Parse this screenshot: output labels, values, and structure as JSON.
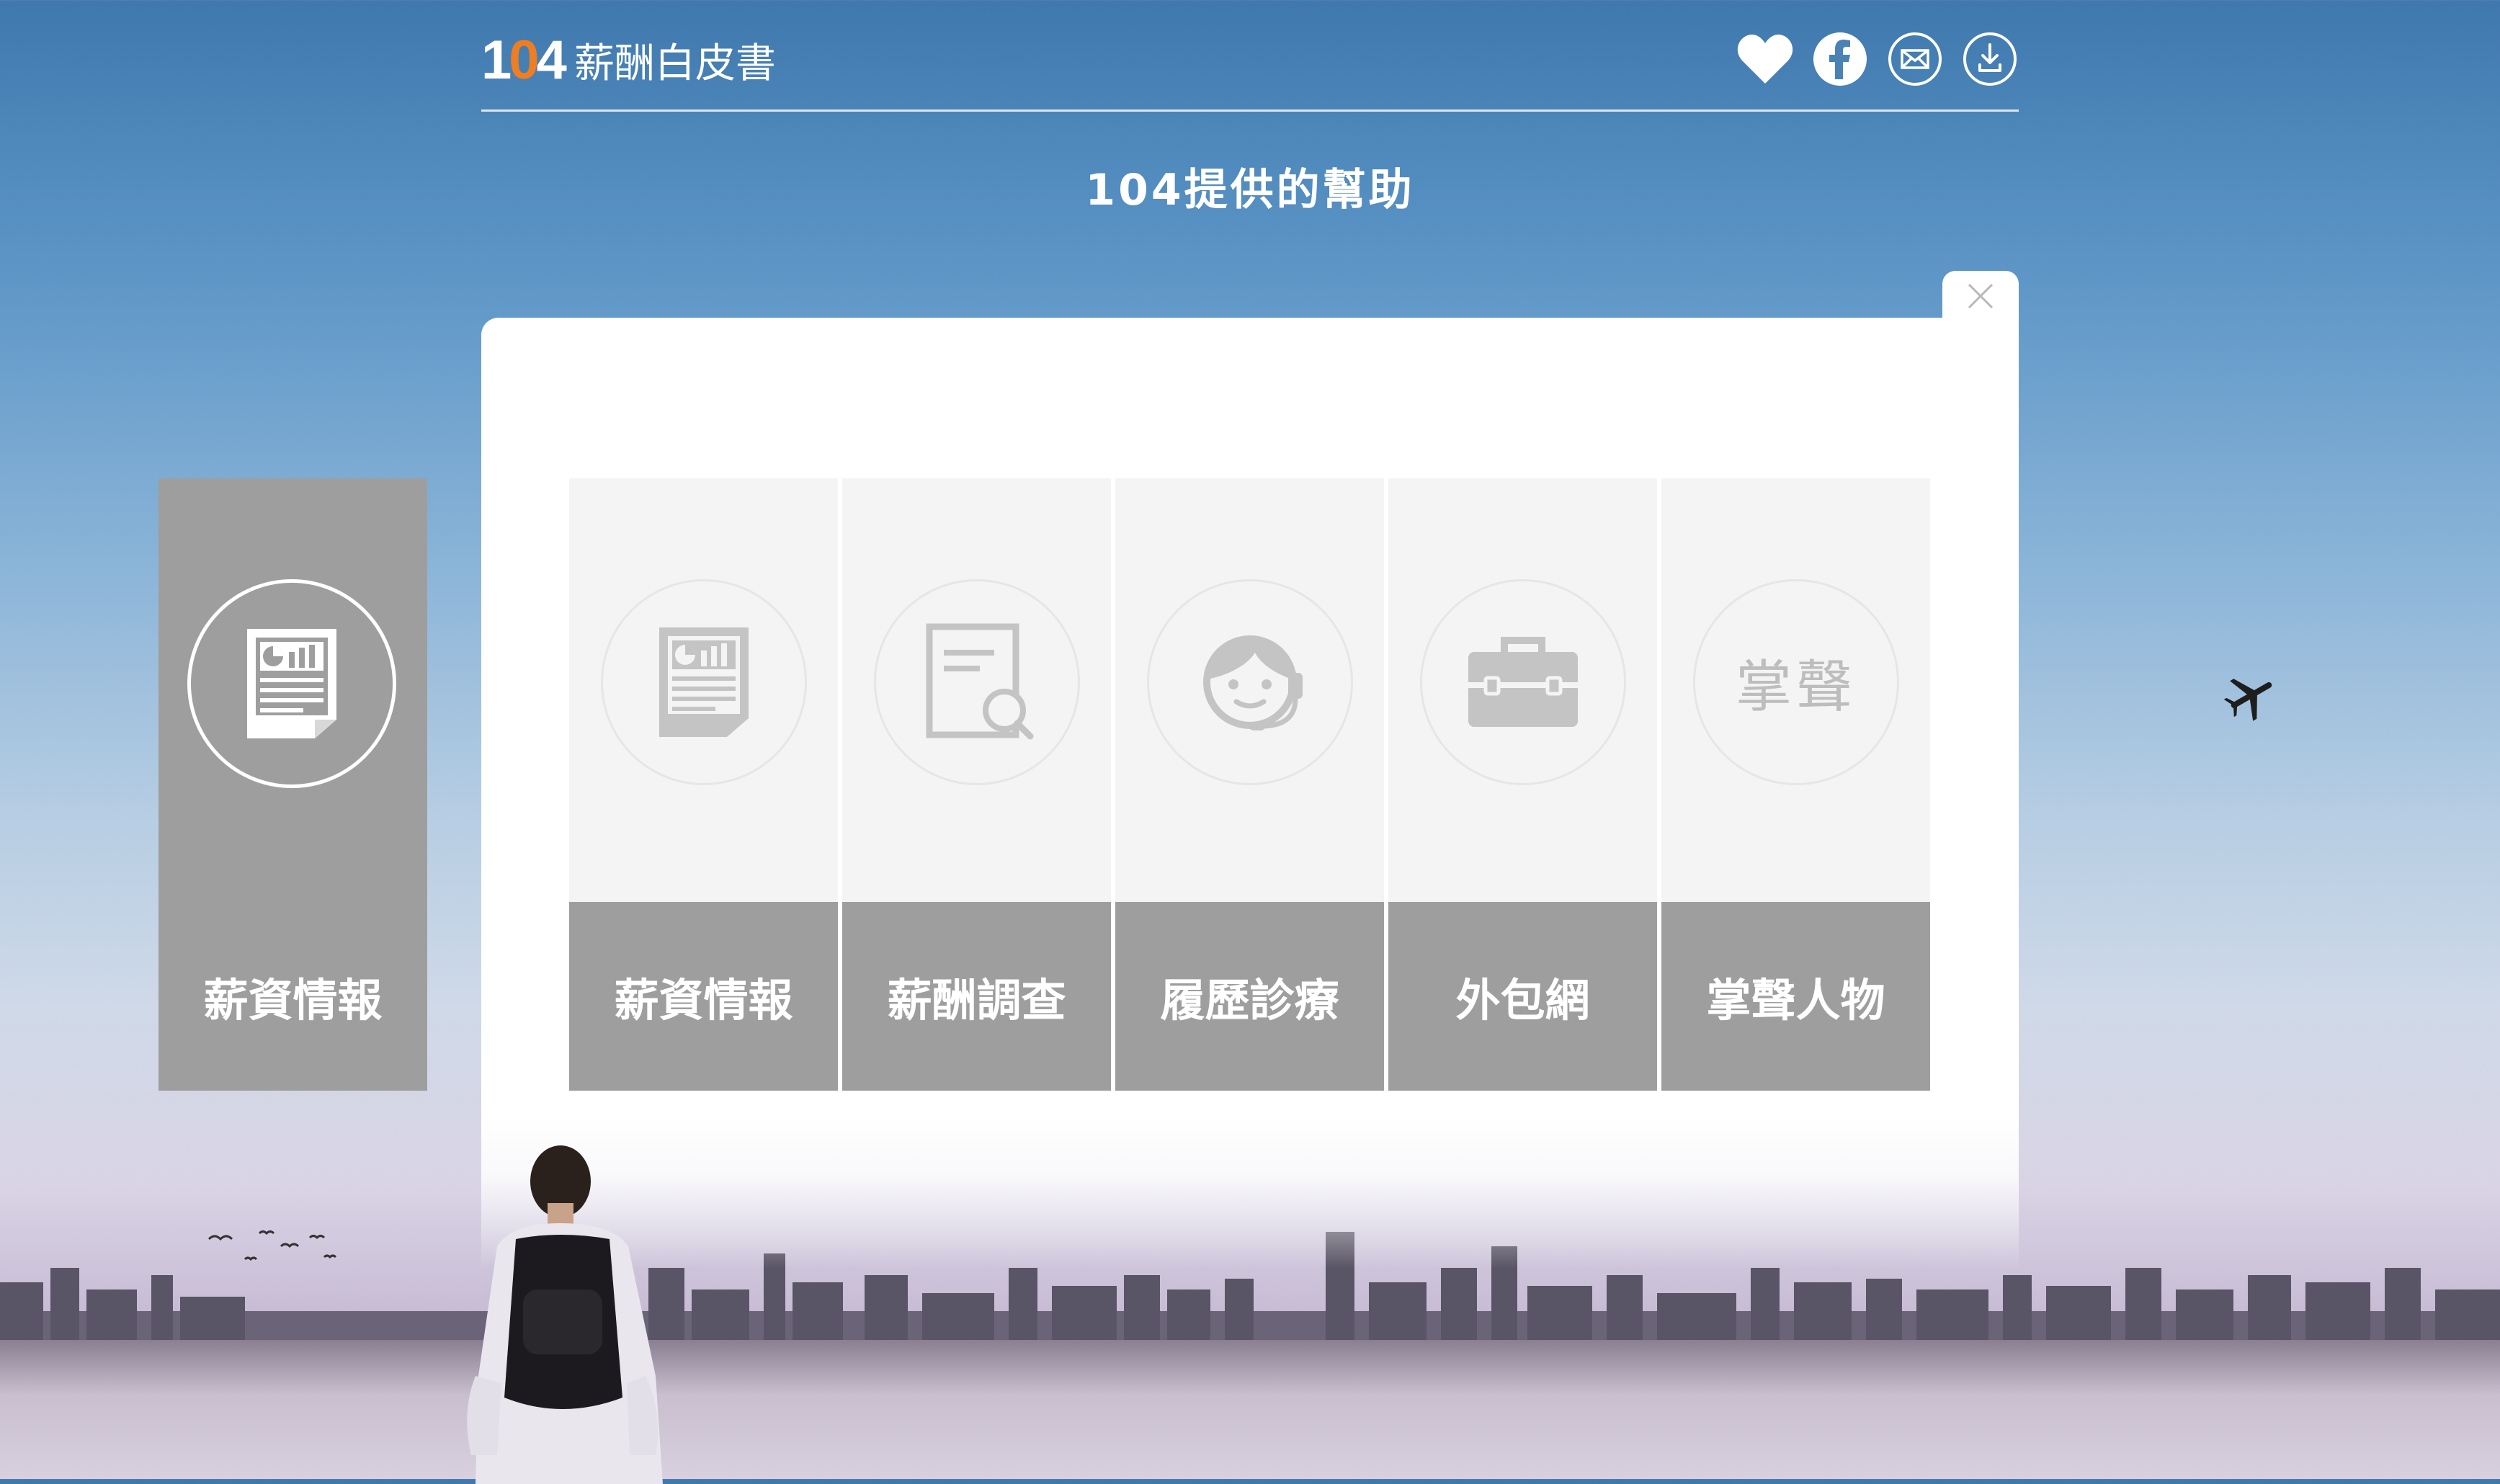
{
  "header": {
    "logo_num_1": "1",
    "logo_num_o": "0",
    "logo_num_4": "4",
    "logo_text": "薪酬白皮書",
    "icons": [
      "heart-icon",
      "facebook-icon",
      "mail-icon",
      "download-icon"
    ]
  },
  "page": {
    "title": "104提供的幫助"
  },
  "side_panel": {
    "label": "薪資情報",
    "icon": "report-icon"
  },
  "cards": [
    {
      "label": "薪資情報",
      "icon": "report-icon"
    },
    {
      "label": "薪酬調查",
      "icon": "document-search-icon"
    },
    {
      "label": "履歷診療",
      "icon": "headset-agent-icon"
    },
    {
      "label": "外包網",
      "icon": "briefcase-icon"
    },
    {
      "label": "掌聲人物",
      "icon_text": "掌聲"
    }
  ],
  "colors": {
    "card_label_bg": "#9e9e9e",
    "card_bg": "#f4f4f4",
    "logo_accent": "#ef7d22"
  }
}
